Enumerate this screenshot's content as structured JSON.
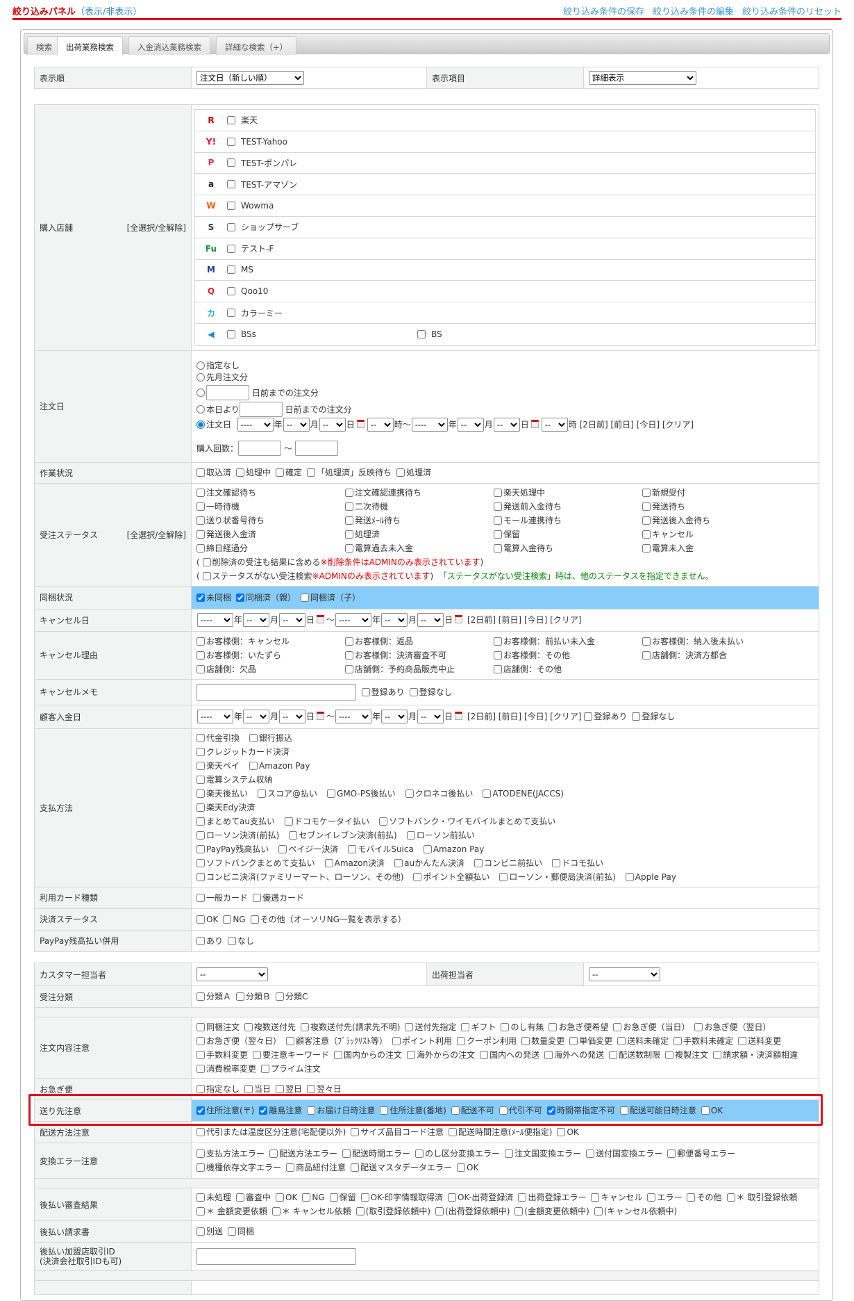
{
  "header": {
    "title": "絞り込みパネル",
    "toggle": "（表示/非表示）",
    "links": [
      "絞り込み条件の保存",
      "絞り込み条件の編集",
      "絞り込み条件のリセット"
    ]
  },
  "tabs": [
    "検索",
    "出荷業務検索",
    "入金消込業務検索",
    "詳細な検索（+）"
  ],
  "sort": {
    "label": "表示順",
    "value": "注文日（新しい順）",
    "display_label": "表示項目",
    "display_value": "詳細表示"
  },
  "select_all": "[全選択/全解除]",
  "date": {
    "year": "年",
    "month": "月",
    "day": "日",
    "hour": "時",
    "tilde": "～",
    "blank_year": "----",
    "blank": "--",
    "quick": [
      "[2日前]",
      "[前日]",
      "[今日]",
      "[クリア]"
    ]
  },
  "shops": {
    "label": "購入店舗",
    "items": [
      {
        "name": "楽天",
        "icon": "R",
        "color": "#bf0000"
      },
      {
        "name": "TEST-Yahoo",
        "icon": "Y!",
        "color": "#ff0033"
      },
      {
        "name": "TEST-ポンパレ",
        "icon": "P",
        "color": "#e0303a"
      },
      {
        "name": "TEST-アマゾン",
        "icon": "a",
        "color": "#222"
      },
      {
        "name": "Wowma",
        "icon": "W",
        "color": "#ff5a00"
      },
      {
        "name": "ショップサーブ",
        "icon": "S",
        "color": "#234"
      },
      {
        "name": "テスト-F",
        "icon": "Fu",
        "color": "#1a9a3a"
      },
      {
        "name": "MS",
        "icon": "M",
        "color": "#1a3a9a"
      },
      {
        "name": "Qoo10",
        "icon": "Q",
        "color": "#e02030"
      },
      {
        "name": "カラーミー",
        "icon": "カ",
        "color": "#2ab0e0"
      },
      {
        "name": "BSs",
        "icon": "◀",
        "color": "#1a8ad8",
        "extra": "BS"
      }
    ]
  },
  "order_date": {
    "label": "注文日",
    "opts": [
      "指定なし",
      "先月注文分",
      "日前までの注文分",
      "本日より",
      "日前までの注文分",
      "注文日"
    ],
    "count_label": "購入回数："
  },
  "work": {
    "label": "作業状況",
    "items": [
      {
        "l": "取込済"
      },
      {
        "l": "処理中"
      },
      {
        "l": "確定"
      },
      {
        "l": "「処理済」反映待ち"
      },
      {
        "l": "処理済"
      }
    ]
  },
  "status": {
    "label": "受注ステータス",
    "items": [
      {
        "l": "注文確認待ち"
      },
      {
        "l": "注文確認連携待ち"
      },
      {
        "l": "楽天処理中"
      },
      {
        "l": "新規受付"
      },
      {
        "l": "一時待機"
      },
      {
        "l": "二次待機"
      },
      {
        "l": "発送前入金待ち"
      },
      {
        "l": "発送待ち"
      },
      {
        "l": "送り状番号待ち"
      },
      {
        "l": "発送ﾒｰﾙ待ち"
      },
      {
        "l": "モール連携待ち"
      },
      {
        "l": "発送後入金待ち"
      },
      {
        "l": "発送後入金済"
      },
      {
        "l": "処理済"
      },
      {
        "l": "保留"
      },
      {
        "l": "キャンセル"
      },
      {
        "l": "締日経過分"
      },
      {
        "l": "電算過去未入金"
      },
      {
        "l": "電算入金待ち"
      },
      {
        "l": "電算未入金"
      }
    ],
    "deleted": "削除済の受注も結果に含める",
    "deleted_note": "※削除条件はADMINのみ表示されています",
    "nostatus": "ステータスがない受注検索",
    "nostatus_note": "※ADMINのみ表示されています",
    "nostatus_help": "「ステータスがない受注検索」時は、他のステータスを指定できません。"
  },
  "bundle": {
    "label": "同梱状況",
    "items": [
      {
        "l": "未同梱",
        "c": true
      },
      {
        "l": "同梱済（親）",
        "c": true
      },
      {
        "l": "同梱済（子）"
      }
    ]
  },
  "cancel_date": {
    "label": "キャンセル日"
  },
  "cancel_reason": {
    "label": "キャンセル理由",
    "items": [
      {
        "l": "お客様側：キャンセル"
      },
      {
        "l": "お客様側：返品"
      },
      {
        "l": "お客様側：前払い未入金"
      },
      {
        "l": "お客様側：納入後未払い"
      },
      {
        "l": "お客様側：いたずら"
      },
      {
        "l": "お客様側：決済審査不可"
      },
      {
        "l": "お客様側：その他"
      },
      {
        "l": "店舗側：決済方都合"
      },
      {
        "l": "店舗側：欠品"
      },
      {
        "l": "店舗側：予約商品販売中止"
      },
      {
        "l": "店舗側：その他"
      }
    ]
  },
  "cancel_memo": {
    "label": "キャンセルメモ",
    "items": [
      {
        "l": "登録あり"
      },
      {
        "l": "登録なし"
      }
    ]
  },
  "deposit_date": {
    "label": "顧客入金日",
    "items": [
      {
        "l": "登録あり"
      },
      {
        "l": "登録なし"
      }
    ]
  },
  "payment": {
    "label": "支払方法",
    "lines": [
      [
        {
          "l": "代金引換"
        },
        {
          "l": "銀行振込"
        }
      ],
      [
        {
          "l": "クレジットカード決済"
        }
      ],
      [
        {
          "l": "楽天ペイ"
        },
        {
          "l": "Amazon Pay"
        }
      ],
      [
        {
          "l": "電算システム収納"
        }
      ],
      [
        {
          "l": "楽天後払い"
        },
        {
          "l": "スコア@払い"
        },
        {
          "l": "GMO-PS後払い"
        },
        {
          "l": "クロネコ後払い"
        },
        {
          "l": "ATODENE(JACCS)"
        }
      ],
      [
        {
          "l": "楽天Edy決済"
        }
      ],
      [
        {
          "l": "まとめてau支払い"
        },
        {
          "l": "ドコモケータイ払い"
        },
        {
          "l": "ソフトバンク・ワイモバイルまとめて支払い"
        }
      ],
      [
        {
          "l": "ローソン決済(前払)"
        },
        {
          "l": "セブンイレブン決済(前払)"
        },
        {
          "l": "ローソン前払い"
        }
      ],
      [
        {
          "l": "PayPay残高払い"
        },
        {
          "l": "ペイジー決済"
        },
        {
          "l": "モバイルSuica"
        },
        {
          "l": "Amazon Pay"
        }
      ],
      [
        {
          "l": "ソフトバンクまとめて支払い"
        },
        {
          "l": "Amazon決済"
        },
        {
          "l": "auかんたん決済"
        },
        {
          "l": "コンビニ前払い"
        },
        {
          "l": "ドコモ払い"
        },
        {
          "l": "コンビニ決済(ファミリーマート、ローソン、その他)"
        },
        {
          "l": "ポイント全額払い"
        },
        {
          "l": "ローソン・郵便局決済(前払)"
        },
        {
          "l": "Apple Pay"
        }
      ]
    ]
  },
  "card_type": {
    "label": "利用カード種類",
    "items": [
      {
        "l": "一般カード"
      },
      {
        "l": "優遇カード"
      }
    ]
  },
  "settle_status": {
    "label": "決済ステータス",
    "items": [
      {
        "l": "OK"
      },
      {
        "l": "NG"
      },
      {
        "l": "その他（オーソリNG一覧を表示する）"
      }
    ]
  },
  "paypay": {
    "label": "PayPay残高払い併用",
    "items": [
      {
        "l": "あり"
      },
      {
        "l": "なし"
      }
    ]
  },
  "staff": {
    "label": "カスタマー担当者",
    "value": "--",
    "ship_label": "出荷担当者",
    "ship_value": "--"
  },
  "category": {
    "label": "受注分類",
    "items": [
      {
        "l": "分類Ａ"
      },
      {
        "l": "分類Ｂ"
      },
      {
        "l": "分類C"
      }
    ]
  },
  "content_note": {
    "label": "注文内容注意",
    "items": [
      {
        "l": "同梱注文"
      },
      {
        "l": "複数送付先"
      },
      {
        "l": "複数送付先(請求先不明)"
      },
      {
        "l": "送付先指定"
      },
      {
        "l": "ギフト"
      },
      {
        "l": "のし有無"
      },
      {
        "l": "お急ぎ便希望"
      },
      {
        "l": "お急ぎ便（当日）"
      },
      {
        "l": "お急ぎ便（翌日）"
      },
      {
        "l": "お急ぎ便（翌々日）"
      },
      {
        "l": "顧客注意（ﾌﾞﾗｯｸﾘｽﾄ等）"
      },
      {
        "l": "ポイント利用"
      },
      {
        "l": "クーポン利用"
      },
      {
        "l": "数量変更"
      },
      {
        "l": "単価変更"
      },
      {
        "l": "送料未確定"
      },
      {
        "l": "手数料未確定"
      },
      {
        "l": "送料変更"
      },
      {
        "l": "手数料変更"
      },
      {
        "l": "要注意キーワード"
      },
      {
        "l": "国内からの注文"
      },
      {
        "l": "海外からの注文"
      },
      {
        "l": "国内への発送"
      },
      {
        "l": "海外への発送"
      },
      {
        "l": "配送数制限"
      },
      {
        "l": "複製注文"
      },
      {
        "l": "請求額・決済額相違"
      },
      {
        "l": "消費税率変更"
      },
      {
        "l": "プライム注文"
      }
    ]
  },
  "express": {
    "label": "お急ぎ便",
    "items": [
      {
        "l": "指定なし"
      },
      {
        "l": "当日"
      },
      {
        "l": "翌日"
      },
      {
        "l": "翌々日"
      }
    ]
  },
  "dest_note": {
    "label": "送り先注意",
    "items": [
      {
        "l": "住所注意(〒)",
        "c": true
      },
      {
        "l": "離島注意",
        "c": true
      },
      {
        "l": "お届け日時注意"
      },
      {
        "l": "住所注意(番地)"
      },
      {
        "l": "配送不可"
      },
      {
        "l": "代引不可"
      },
      {
        "l": "時間帯指定不可",
        "c": true
      },
      {
        "l": "配送可能日時注意"
      },
      {
        "l": "OK"
      }
    ]
  },
  "ship_note": {
    "label": "配送方法注意",
    "items": [
      {
        "l": "代引または温度区分注意(宅配便以外)"
      },
      {
        "l": "サイズ品目コード注意"
      },
      {
        "l": "配送時間注意(ﾒｰﾙ便指定)"
      },
      {
        "l": "OK"
      }
    ]
  },
  "conv_err": {
    "label": "変換エラー注意",
    "items": [
      {
        "l": "支払方法エラー"
      },
      {
        "l": "配送方法エラー"
      },
      {
        "l": "配送時間エラー"
      },
      {
        "l": "のし区分変換エラー"
      },
      {
        "l": "注文国変換エラー"
      },
      {
        "l": "送付国変換エラー"
      },
      {
        "l": "郵便番号エラー"
      },
      {
        "l": "機種依存文字エラー"
      },
      {
        "l": "商品紐付注意"
      },
      {
        "l": "配送マスタデータエラー"
      },
      {
        "l": "OK"
      }
    ]
  },
  "postpay_review": {
    "label": "後払い審査結果",
    "items": [
      {
        "l": "未処理"
      },
      {
        "l": "審査中"
      },
      {
        "l": "OK"
      },
      {
        "l": "NG"
      },
      {
        "l": "保留"
      },
      {
        "l": "OK-印字情報取得済"
      },
      {
        "l": "OK-出荷登録済"
      },
      {
        "l": "出荷登録エラー"
      },
      {
        "l": "キャンセル"
      },
      {
        "l": "エラー"
      },
      {
        "l": "その他"
      },
      {
        "l": "＊ 取引登録依頼"
      },
      {
        "l": "＊ 金額変更依頼"
      },
      {
        "l": "＊ キャンセル依頼"
      },
      {
        "l": "(取引登録依頼中)"
      },
      {
        "l": "(出荷登録依頼中)"
      },
      {
        "l": "(金額変更依頼中)"
      },
      {
        "l": "(キャンセル依頼中)"
      }
    ]
  },
  "postpay_invoice": {
    "label": "後払い請求書",
    "items": [
      {
        "l": "別送"
      },
      {
        "l": "同梱"
      }
    ]
  },
  "postpay_id": {
    "label": "後払い加盟店取引ID",
    "sub": "(決済会社取引IDも可)"
  }
}
